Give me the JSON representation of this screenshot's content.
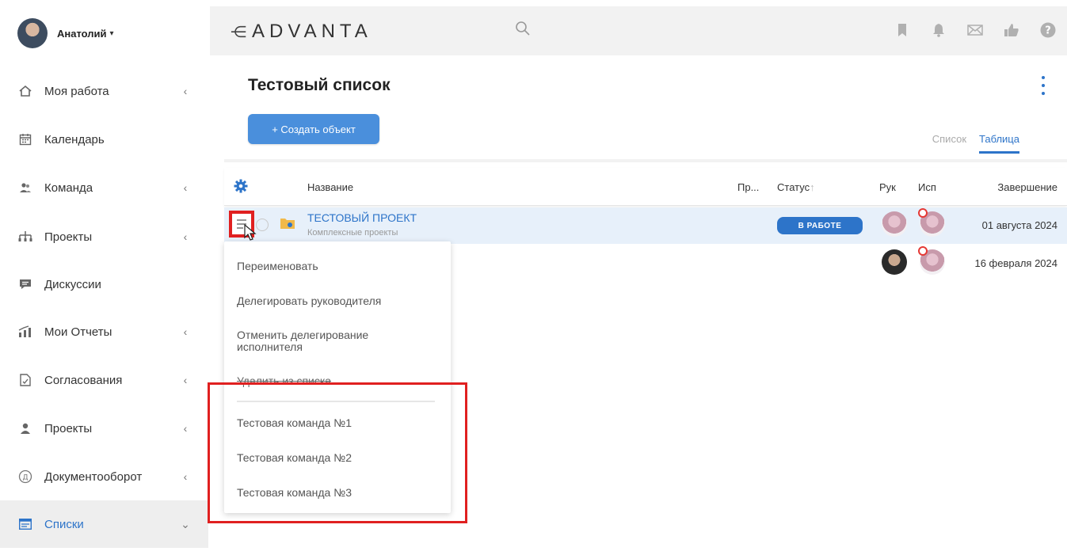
{
  "user": {
    "name": "Анатолий",
    "caret": "▾"
  },
  "sidebar": {
    "items": [
      {
        "label": "Моя работа",
        "icon": "home-icon",
        "chevron": "‹"
      },
      {
        "label": "Календарь",
        "icon": "calendar-icon",
        "chevron": ""
      },
      {
        "label": "Команда",
        "icon": "team-icon",
        "chevron": "‹"
      },
      {
        "label": "Проекты",
        "icon": "hierarchy-icon",
        "chevron": "‹"
      },
      {
        "label": "Дискуссии",
        "icon": "chat-icon",
        "chevron": ""
      },
      {
        "label": "Мои Отчеты",
        "icon": "reports-icon",
        "chevron": "‹"
      },
      {
        "label": "Согласования",
        "icon": "document-icon",
        "chevron": "‹"
      },
      {
        "label": "Проекты",
        "icon": "person-icon",
        "chevron": "‹"
      },
      {
        "label": "Документооборот",
        "icon": "docflow-icon",
        "chevron": "‹"
      },
      {
        "label": "Списки",
        "icon": "list-icon",
        "chevron": "⌄",
        "active": true
      }
    ]
  },
  "header": {
    "logo_mark": "⋲",
    "logo_text": "ADVANTA",
    "icons": [
      "bookmark-icon",
      "bell-icon",
      "mail-icon",
      "thumbs-up-icon",
      "help-icon"
    ]
  },
  "page": {
    "title": "Тестовый список",
    "create_label": "+ Создать объект",
    "view_tabs": [
      {
        "label": "Список",
        "active": false
      },
      {
        "label": "Таблица",
        "active": true
      }
    ]
  },
  "table": {
    "columns": {
      "name": "Название",
      "priority": "Пр...",
      "status": "Статус",
      "manager": "Рук",
      "executor": "Исп",
      "end": "Завершение"
    },
    "rows": [
      {
        "name": "ТЕСТОВЫЙ ПРОЕКТ",
        "subtitle": "Комплексные проекты",
        "status": "В РАБОТЕ",
        "end": "01 августа 2024"
      },
      {
        "name": "",
        "subtitle": "",
        "status": "",
        "end": "16 февраля 2024"
      }
    ]
  },
  "context_menu": {
    "rename": "Переименовать",
    "delegate_manager": "Делегировать руководителя",
    "cancel_delegation": "Отменить делегирование исполнителя",
    "remove_from_list": "Удалить из списка",
    "teams": [
      "Тестовая команда №1",
      "Тестовая команда №2",
      "Тестовая команда №3"
    ]
  },
  "colors": {
    "accent": "#2d74c9",
    "button": "#4a8fdc",
    "highlight": "#e02020"
  }
}
